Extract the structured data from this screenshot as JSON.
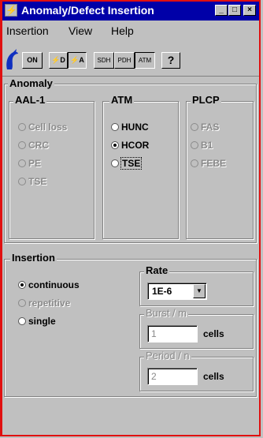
{
  "window": {
    "title": "Anomaly/Defect Insertion",
    "controls": {
      "minimize": "_",
      "maximize": "□",
      "close": "×"
    }
  },
  "menu": [
    {
      "label": "Insertion"
    },
    {
      "label": "View"
    },
    {
      "label": "Help"
    }
  ],
  "toolbar": {
    "on": "ON",
    "err_d": "⚡D",
    "err_a": "⚡A",
    "sdh": "SDH",
    "pdh": "PDH",
    "atm": "ATM",
    "help": "?"
  },
  "anomaly": {
    "label": "Anomaly",
    "aal1": {
      "label": "AAL-1",
      "options": [
        "Cell loss",
        "CRC",
        "PE",
        "TSE"
      ]
    },
    "atm": {
      "label": "ATM",
      "options": [
        "HUNC",
        "HCOR",
        "TSE"
      ],
      "selected": "HCOR"
    },
    "plcp": {
      "label": "PLCP",
      "options": [
        "FAS",
        "B1",
        "FEBE"
      ]
    }
  },
  "insertion": {
    "label": "Insertion",
    "options": [
      "continuous",
      "repetitive",
      "single"
    ],
    "selected": "continuous",
    "rate": {
      "label": "Rate",
      "value": "1E-6"
    },
    "burst": {
      "label": "Burst / m",
      "value": "1",
      "unit": "cells"
    },
    "period": {
      "label": "Period / n",
      "value": "2",
      "unit": "cells"
    }
  }
}
